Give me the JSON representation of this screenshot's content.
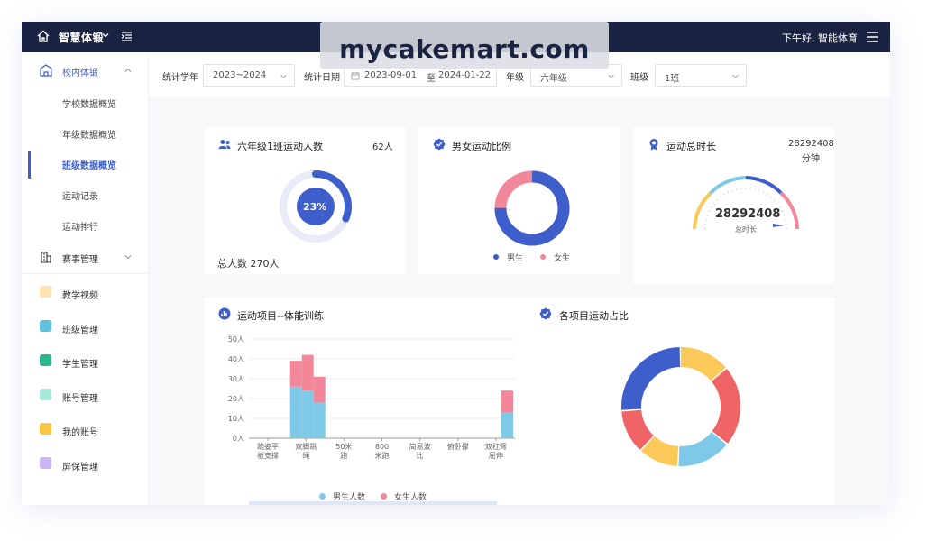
{
  "topbar": {
    "brand": "智慧体锻",
    "greeting": "下午好, 智能体育"
  },
  "watermark": "mycakemart.com",
  "sidebar": {
    "group1": "校内体锻",
    "subs": [
      "学校数据概览",
      "年级数据概览",
      "班级数据概览",
      "运动记录",
      "运动排行"
    ],
    "group2": "赛事管理",
    "items": [
      "教学视频",
      "班级管理",
      "学生管理",
      "账号管理",
      "我的账号",
      "屏保管理"
    ]
  },
  "filters": {
    "year_label": "统计学年",
    "year_value": "2023~2024",
    "date_label": "统计日期",
    "date_start": "2023-09-01",
    "date_sep": "至",
    "date_end": "2024-01-22",
    "grade_label": "年级",
    "grade_value": "六年级",
    "class_label": "班级",
    "class_value": "1班"
  },
  "card1": {
    "title": "六年级1班运动人数",
    "count": "62人",
    "percent": "23%",
    "percent_value": 0.23,
    "total": "总人数 270人"
  },
  "card2": {
    "title": "男女运动比例",
    "legend": [
      "男生",
      "女生"
    ],
    "male_ratio": 0.75
  },
  "card3": {
    "title": "运动总时长",
    "value": "28292408",
    "unit": "分钟",
    "gauge_value": "28292408",
    "gauge_label": "总时长"
  },
  "card5": {
    "title": "各项目运动占比"
  },
  "colors": {
    "blue": "#3d5ecb",
    "pink": "#f2879a",
    "lightblue": "#7ec8e8",
    "yellow": "#fbc85a",
    "red": "#ef6464",
    "navy": "#1b2342"
  },
  "chart_data": [
    {
      "type": "bar",
      "title": "运动项目--体能训练",
      "categories": [
        "跪姿平板支撑",
        "双脚跳绳",
        "50米跑",
        "800米跑",
        "简易波比",
        "俯卧撑",
        "双杠臂屈伸"
      ],
      "y_tick_labels": [
        "0人",
        "10人",
        "20人",
        "30人",
        "40人",
        "50人"
      ],
      "ylim": [
        0,
        50
      ],
      "stacked": true,
      "bar_groups": [
        {
          "category": "双脚跳绳",
          "bars": [
            {
              "male": 26,
              "female": 13
            },
            {
              "male": 24,
              "female": 18
            },
            {
              "male": 18,
              "female": 13
            }
          ]
        },
        {
          "category": "双杠臂屈伸",
          "bars": [
            {
              "male": 13,
              "female": 11
            }
          ]
        }
      ],
      "legend": [
        "男生人数",
        "女生人数"
      ],
      "grid": true
    },
    {
      "type": "pie",
      "title": "各项目运动占比",
      "slices": [
        {
          "color": "#fbc85a",
          "value": 14
        },
        {
          "color": "#ef6464",
          "value": 22
        },
        {
          "color": "#7ec8e8",
          "value": 15
        },
        {
          "color": "#fbc85a",
          "value": 11
        },
        {
          "color": "#ef6464",
          "value": 12
        },
        {
          "color": "#3d5ecb",
          "value": 26
        }
      ]
    }
  ]
}
